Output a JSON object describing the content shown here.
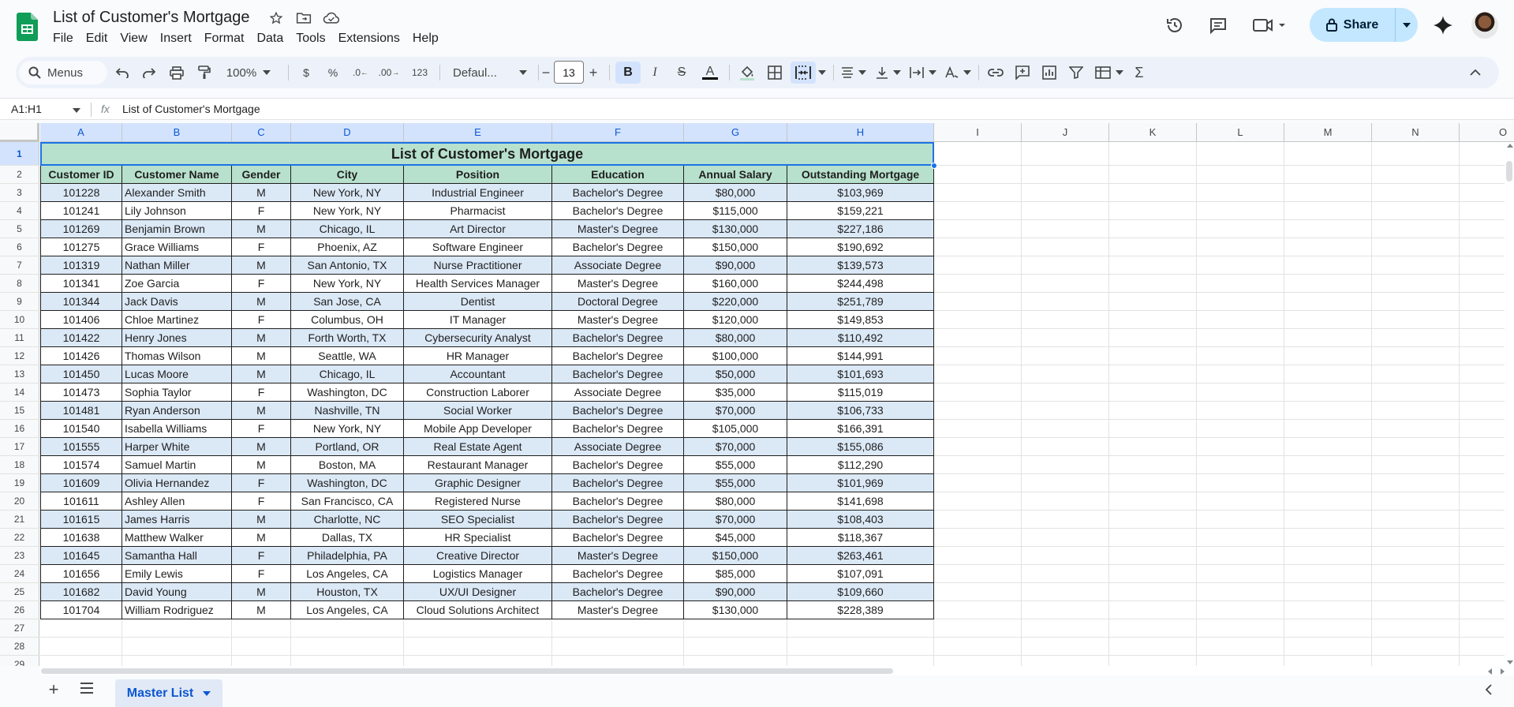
{
  "app": {
    "doc_title": "List of Customer's Mortgage",
    "menu": [
      "File",
      "Edit",
      "View",
      "Insert",
      "Format",
      "Data",
      "Tools",
      "Extensions",
      "Help"
    ],
    "share_label": "Share",
    "brand_color": "#0f9d58",
    "accent_color": "#c2e7ff"
  },
  "toolbar": {
    "menus_label": "Menus",
    "zoom": "100%",
    "currency": "$",
    "percent": "%",
    "dec_decrease": ".0",
    "dec_increase": ".00",
    "number_format": "123",
    "font": "Defaul...",
    "font_size": "13",
    "bold": "B",
    "italic": "I",
    "strike": "S",
    "text_color": "A"
  },
  "formula_bar": {
    "name_box": "A1:H1",
    "fx": "fx",
    "value": "List of Customer's Mortgage"
  },
  "grid": {
    "columns": [
      "A",
      "B",
      "C",
      "D",
      "E",
      "F",
      "G",
      "H",
      "I",
      "J",
      "K",
      "L",
      "M",
      "N",
      "O"
    ],
    "selected_columns": [
      "A",
      "B",
      "C",
      "D",
      "E",
      "F",
      "G",
      "H"
    ],
    "row_numbers": [
      "1",
      "2",
      "3",
      "4",
      "5",
      "6",
      "7",
      "8",
      "9",
      "10",
      "11",
      "12",
      "13",
      "14",
      "15",
      "16",
      "17",
      "18",
      "19",
      "20",
      "21",
      "22",
      "23",
      "24",
      "25",
      "26",
      "27",
      "28",
      "29"
    ],
    "selected_row": "1",
    "title": "List of Customer's Mortgage",
    "headers": [
      "Customer ID",
      "Customer Name",
      "Gender",
      "City",
      "Position",
      "Education",
      "Annual Salary",
      "Outstanding Mortgage"
    ],
    "rows": [
      [
        "101228",
        "Alexander Smith",
        "M",
        "New York, NY",
        "Industrial Engineer",
        "Bachelor's Degree",
        "$80,000",
        "$103,969"
      ],
      [
        "101241",
        "Lily Johnson",
        "F",
        "New York, NY",
        "Pharmacist",
        "Bachelor's Degree",
        "$115,000",
        "$159,221"
      ],
      [
        "101269",
        "Benjamin Brown",
        "M",
        "Chicago, IL",
        "Art Director",
        "Master's Degree",
        "$130,000",
        "$227,186"
      ],
      [
        "101275",
        "Grace Williams",
        "F",
        "Phoenix, AZ",
        "Software Engineer",
        "Bachelor's Degree",
        "$150,000",
        "$190,692"
      ],
      [
        "101319",
        "Nathan Miller",
        "M",
        "San Antonio, TX",
        "Nurse Practitioner",
        "Associate Degree",
        "$90,000",
        "$139,573"
      ],
      [
        "101341",
        "Zoe Garcia",
        "F",
        "New York, NY",
        "Health Services Manager",
        "Master's Degree",
        "$160,000",
        "$244,498"
      ],
      [
        "101344",
        "Jack Davis",
        "M",
        "San Jose, CA",
        "Dentist",
        "Doctoral Degree",
        "$220,000",
        "$251,789"
      ],
      [
        "101406",
        "Chloe Martinez",
        "F",
        "Columbus, OH",
        "IT Manager",
        "Master's Degree",
        "$120,000",
        "$149,853"
      ],
      [
        "101422",
        "Henry Jones",
        "M",
        "Forth Worth, TX",
        "Cybersecurity Analyst",
        "Bachelor's Degree",
        "$80,000",
        "$110,492"
      ],
      [
        "101426",
        "Thomas Wilson",
        "M",
        "Seattle, WA",
        "HR Manager",
        "Bachelor's Degree",
        "$100,000",
        "$144,991"
      ],
      [
        "101450",
        "Lucas Moore",
        "M",
        "Chicago, IL",
        "Accountant",
        "Bachelor's Degree",
        "$50,000",
        "$101,693"
      ],
      [
        "101473",
        "Sophia Taylor",
        "F",
        "Washington, DC",
        "Construction Laborer",
        "Associate Degree",
        "$35,000",
        "$115,019"
      ],
      [
        "101481",
        "Ryan Anderson",
        "M",
        "Nashville, TN",
        "Social Worker",
        "Bachelor's Degree",
        "$70,000",
        "$106,733"
      ],
      [
        "101540",
        "Isabella Williams",
        "F",
        "New York, NY",
        "Mobile App Developer",
        "Bachelor's Degree",
        "$105,000",
        "$166,391"
      ],
      [
        "101555",
        "Harper White",
        "M",
        "Portland, OR",
        "Real Estate Agent",
        "Associate Degree",
        "$70,000",
        "$155,086"
      ],
      [
        "101574",
        "Samuel Martin",
        "M",
        "Boston, MA",
        "Restaurant Manager",
        "Bachelor's Degree",
        "$55,000",
        "$112,290"
      ],
      [
        "101609",
        "Olivia Hernandez",
        "F",
        "Washington, DC",
        "Graphic Designer",
        "Bachelor's Degree",
        "$55,000",
        "$101,969"
      ],
      [
        "101611",
        "Ashley Allen",
        "F",
        "San Francisco, CA",
        "Registered Nurse",
        "Bachelor's Degree",
        "$80,000",
        "$141,698"
      ],
      [
        "101615",
        "James Harris",
        "M",
        "Charlotte, NC",
        "SEO Specialist",
        "Bachelor's Degree",
        "$70,000",
        "$108,403"
      ],
      [
        "101638",
        "Matthew Walker",
        "M",
        "Dallas, TX",
        "HR Specialist",
        "Bachelor's Degree",
        "$45,000",
        "$118,367"
      ],
      [
        "101645",
        "Samantha Hall",
        "F",
        "Philadelphia, PA",
        "Creative Director",
        "Master's Degree",
        "$150,000",
        "$263,461"
      ],
      [
        "101656",
        "Emily Lewis",
        "F",
        "Los Angeles, CA",
        "Logistics Manager",
        "Bachelor's Degree",
        "$85,000",
        "$107,091"
      ],
      [
        "101682",
        "David Young",
        "M",
        "Houston, TX",
        "UX/UI Designer",
        "Bachelor's Degree",
        "$90,000",
        "$109,660"
      ],
      [
        "101704",
        "William Rodriguez",
        "M",
        "Los Angeles, CA",
        "Cloud Solutions Architect",
        "Master's Degree",
        "$130,000",
        "$228,389"
      ]
    ],
    "colors": {
      "title_fill": "#b7e1cd",
      "header_fill": "#b7e1cd",
      "band_fill": "#dbe8f6",
      "plain_fill": "#ffffff"
    }
  },
  "sheets": {
    "active_tab": "Master List"
  }
}
